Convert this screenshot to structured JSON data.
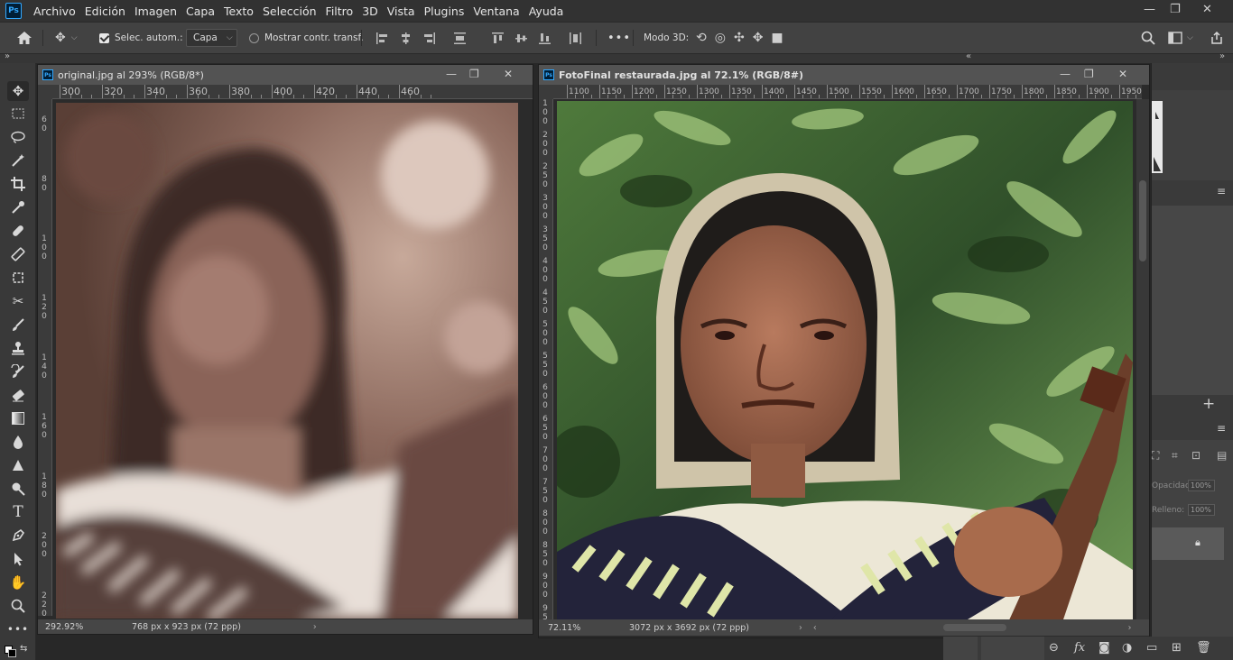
{
  "app": {
    "logo": "Ps"
  },
  "menu": [
    "Archivo",
    "Edición",
    "Imagen",
    "Capa",
    "Texto",
    "Selección",
    "Filtro",
    "3D",
    "Vista",
    "Plugins",
    "Ventana",
    "Ayuda"
  ],
  "window_controls": {
    "minimize": "—",
    "restore": "❐",
    "close": "✕"
  },
  "options": {
    "auto_select_label": "Selec. autom.:",
    "auto_select_checked": true,
    "layer_select_value": "Capa",
    "show_transform_label": "Mostrar contr. transf.",
    "show_transform_checked": false,
    "mode3d_label": "Modo 3D:",
    "more": "•••"
  },
  "collapse_left": "»",
  "collapse_right": "«",
  "tools": [
    "move-tool",
    "marquee-tool",
    "lasso-tool",
    "magic-wand-tool",
    "crop-tool",
    "eyedropper-tool",
    "healing-brush-tool",
    "patch-tool",
    "content-aware-tool",
    "red-eye-tool",
    "brush-tool",
    "clone-stamp-tool",
    "history-brush-tool",
    "eraser-tool",
    "gradient-tool",
    "blur-tool",
    "sharpen-tool",
    "dodge-tool",
    "type-tool",
    "pen-tool",
    "path-selection-tool",
    "hand-tool",
    "zoom-tool",
    "more-tools"
  ],
  "doc_original": {
    "title": "original.jpg al 293% (RGB/8*)",
    "ruler_h": [
      "300",
      "320",
      "340",
      "360",
      "380",
      "400",
      "420",
      "440",
      "460"
    ],
    "ruler_v": [
      "6 0",
      "8 0",
      "1 0 0",
      "1 2 0",
      "1 4 0",
      "1 6 0",
      "1 8 0",
      "2 0 0",
      "2 2 0"
    ],
    "zoom": "292.92%",
    "size": "768 px x 923 px (72 ppp)"
  },
  "doc_restored": {
    "title": "FotoFinal restaurada.jpg al 72.1% (RGB/8#)",
    "ruler_h": [
      "1100",
      "1150",
      "1200",
      "1250",
      "1300",
      "1350",
      "1400",
      "1450",
      "1500",
      "1550",
      "1600",
      "1650",
      "1700",
      "1750",
      "1800",
      "1850",
      "1900",
      "1950"
    ],
    "ruler_v": [
      "1 0 0",
      "2 0 0",
      "2 5 0",
      "3 0 0",
      "3 5 0",
      "4 0 0",
      "4 5 0",
      "5 0 0",
      "5 5 0",
      "6 0 0",
      "6 5 0",
      "7 0 0",
      "7 5 0",
      "8 0 0",
      "8 5 0",
      "9 0 0",
      "9 5 0"
    ],
    "zoom": "72.11%",
    "size": "3072 px x 3692 px (72 ppp)"
  },
  "right_panel": {
    "opacity_label": "Opacidad:",
    "opacity_value": "100%",
    "fill_label": "Relleno:",
    "fill_value": "100%",
    "add": "+",
    "lock": "🔒"
  }
}
